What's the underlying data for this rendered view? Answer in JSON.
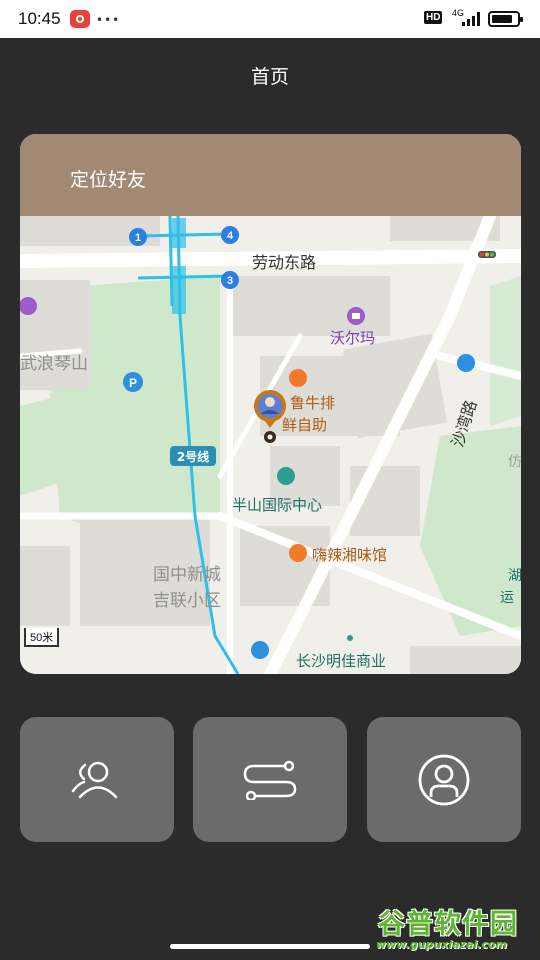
{
  "status_bar": {
    "time": "10:45",
    "notification_icon": "app-notification-icon",
    "more": "•••",
    "hd": "HD",
    "network": "4G",
    "battery_level": 0.7
  },
  "header": {
    "title": "首页"
  },
  "card": {
    "title": "定位好友"
  },
  "map": {
    "roads": {
      "laodong": "劳动东路",
      "shawan": "沙湾路"
    },
    "metro_line": "2号线",
    "metro_exits": [
      "1",
      "4",
      "3"
    ],
    "pois": {
      "walmart": "沃尔玛",
      "langqin": "武浪琴山",
      "luniu_1": "鲁牛排",
      "luniu_2": "鲜自助",
      "banshan": "半山国际中心",
      "haila": "嗨辣湘味馆",
      "guozhong_1": "国中新城",
      "guozhong_2": "吉联小区",
      "mingjia": "长沙明佳商业",
      "edge_1": "湖",
      "edge_2": "运",
      "edge_3": "仿"
    },
    "scale": "50米",
    "colors": {
      "metro": "#2ec0e8",
      "road": "#ffffff",
      "green": "#c8e6c6",
      "block": "#e2e0dc",
      "poi_orange": "#f07a2a",
      "poi_purple": "#9b5dc8",
      "poi_blue": "#2d8fe0"
    }
  },
  "actions": {
    "friends_icon": "friends-icon",
    "route_icon": "route-icon",
    "profile_icon": "profile-icon"
  },
  "watermark": {
    "title": "谷普软件园",
    "url": "www.gupuxiazai.com"
  }
}
